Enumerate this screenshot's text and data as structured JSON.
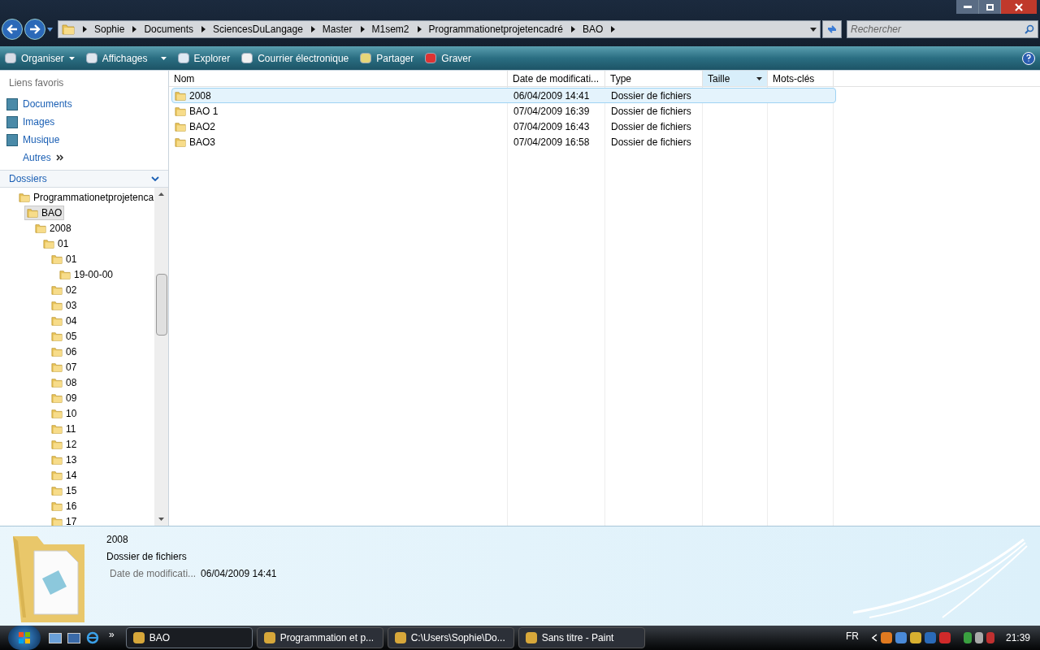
{
  "address": {
    "crumbs": [
      "Sophie",
      "Documents",
      "SciencesDuLangage",
      "Master",
      "M1sem2",
      "Programmationetprojetencadré",
      "BAO"
    ]
  },
  "search": {
    "placeholder": "Rechercher"
  },
  "toolbar": [
    {
      "label": "Organiser",
      "kind": "menu"
    },
    {
      "label": "Affichages",
      "kind": "split"
    },
    {
      "label": "Explorer",
      "kind": "plain"
    },
    {
      "label": "Courrier électronique",
      "kind": "plain"
    },
    {
      "label": "Partager",
      "kind": "plain"
    },
    {
      "label": "Graver",
      "kind": "plain"
    }
  ],
  "sidebar": {
    "heading": "Liens favoris",
    "links": [
      {
        "label": "Documents",
        "kind": "link"
      },
      {
        "label": "Images",
        "kind": "link"
      },
      {
        "label": "Musique",
        "kind": "link"
      },
      {
        "label": "Autres",
        "kind": "more"
      }
    ],
    "folders_title": "Dossiers",
    "tree": [
      {
        "label": "Programmationetprojetenca",
        "selected": false,
        "children": [
          {
            "label": "BAO",
            "selected": true,
            "children": [
              {
                "label": "2008",
                "selected": false,
                "children": [
                  {
                    "label": "01",
                    "selected": false,
                    "children": [
                      {
                        "label": "01",
                        "selected": false,
                        "children": [
                          {
                            "label": "19-00-00",
                            "selected": false
                          }
                        ]
                      },
                      {
                        "label": "02",
                        "selected": false
                      },
                      {
                        "label": "03",
                        "selected": false
                      },
                      {
                        "label": "04",
                        "selected": false
                      },
                      {
                        "label": "05",
                        "selected": false
                      },
                      {
                        "label": "06",
                        "selected": false
                      },
                      {
                        "label": "07",
                        "selected": false
                      },
                      {
                        "label": "08",
                        "selected": false
                      },
                      {
                        "label": "09",
                        "selected": false
                      },
                      {
                        "label": "10",
                        "selected": false
                      },
                      {
                        "label": "11",
                        "selected": false
                      },
                      {
                        "label": "12",
                        "selected": false
                      },
                      {
                        "label": "13",
                        "selected": false
                      },
                      {
                        "label": "14",
                        "selected": false
                      },
                      {
                        "label": "15",
                        "selected": false
                      },
                      {
                        "label": "16",
                        "selected": false
                      },
                      {
                        "label": "17",
                        "selected": false
                      }
                    ]
                  }
                ]
              }
            ]
          }
        ]
      }
    ]
  },
  "table": {
    "columns": [
      {
        "label": "Nom",
        "selected": false
      },
      {
        "label": "Date de modificati...",
        "selected": false
      },
      {
        "label": "Type",
        "selected": false
      },
      {
        "label": "Taille",
        "selected": true
      },
      {
        "label": "Mots-clés",
        "selected": false
      }
    ],
    "rows": [
      {
        "name": "2008",
        "date": "06/04/2009 14:41",
        "type": "Dossier de fichiers",
        "selected": true
      },
      {
        "name": "BAO 1",
        "date": "07/04/2009 16:39",
        "type": "Dossier de fichiers",
        "selected": false
      },
      {
        "name": "BAO2",
        "date": "07/04/2009 16:43",
        "type": "Dossier de fichiers",
        "selected": false
      },
      {
        "name": "BAO3",
        "date": "07/04/2009 16:58",
        "type": "Dossier de fichiers",
        "selected": false
      }
    ]
  },
  "details": {
    "name": "2008",
    "type": "Dossier de fichiers",
    "field_label": "Date de modificati...",
    "field_value": "06/04/2009 14:41"
  },
  "taskbar": {
    "more": "»",
    "buttons": [
      {
        "label": "BAO",
        "selected": true
      },
      {
        "label": "Programmation et p...",
        "selected": false
      },
      {
        "label": "C:\\Users\\Sophie\\Do...",
        "selected": false
      },
      {
        "label": "Sans titre - Paint",
        "selected": false
      }
    ],
    "language": "FR",
    "clock": "21:39"
  }
}
